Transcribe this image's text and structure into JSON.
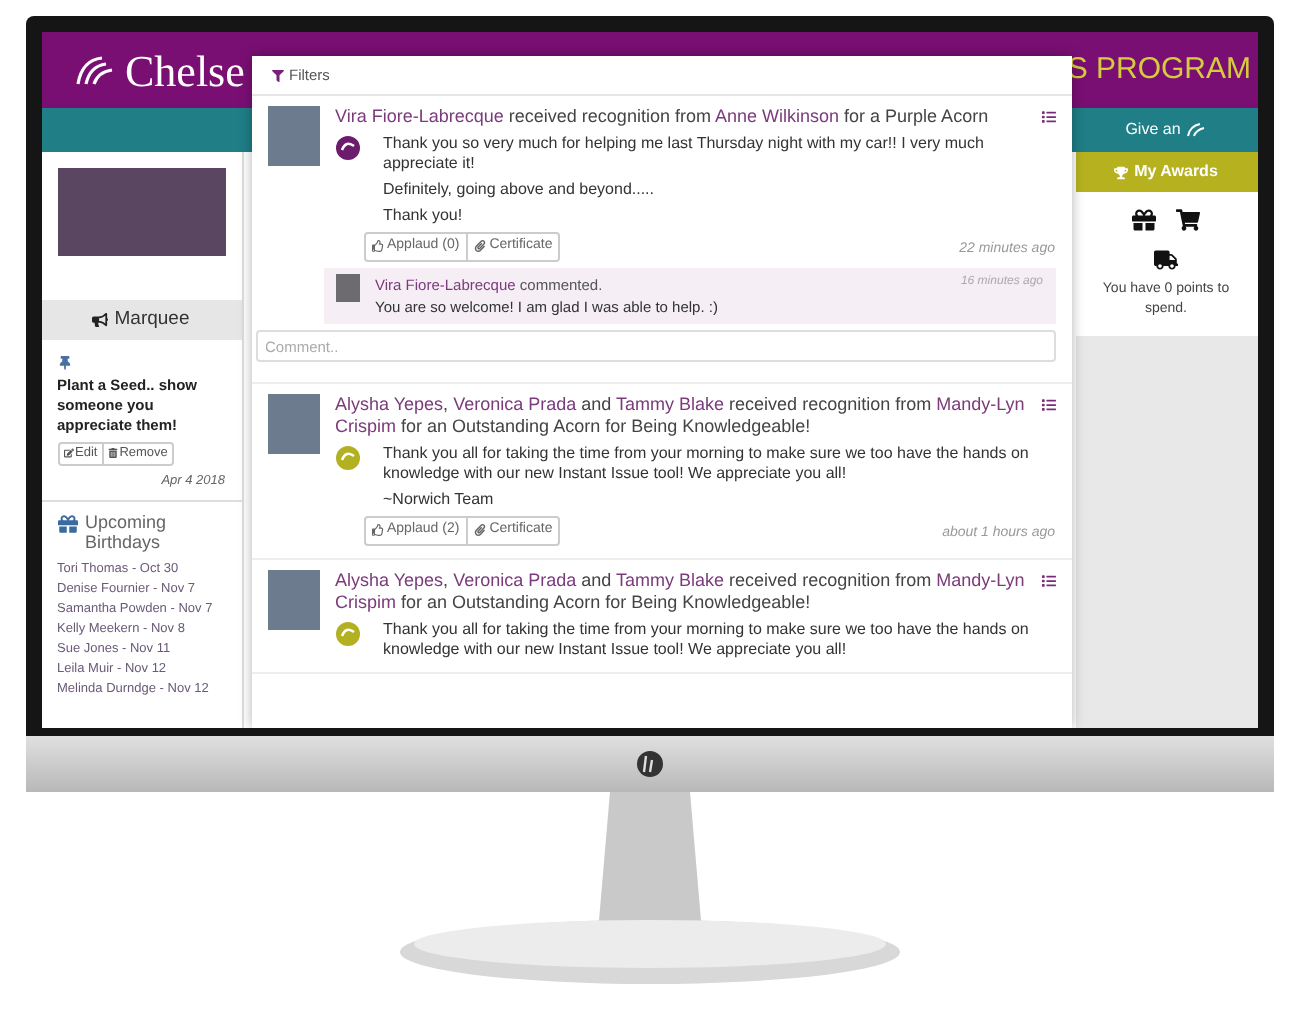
{
  "header": {
    "logo_text": "Chelse",
    "program_text": "S PROGRAM"
  },
  "left_sidebar": {
    "marquee_title": "Marquee",
    "post": {
      "text": "Plant a Seed.. show someone you appreciate them!",
      "buttons": [
        "Edit",
        "Remove"
      ],
      "date": "Apr 4 2018"
    },
    "birthdays": {
      "title": "Upcoming Birthdays",
      "items": [
        "Tori Thomas - Oct 30",
        "Denise Fournier - Nov 7",
        "Samantha Powden - Nov 7",
        "Kelly Meekern - Nov 8",
        "Sue Jones - Nov 11",
        "Leila Muir - Nov 12",
        "Melinda Durndge - Nov 12"
      ]
    }
  },
  "right_sidebar": {
    "give_button": "Give an",
    "awards_button": "My Awards",
    "points_text": "You have 0 points to spend."
  },
  "feed": {
    "filter_label": "Filters",
    "posts": [
      {
        "heading": [
          {
            "text": "Vira Fiore-Labrecque",
            "link": true
          },
          {
            "text": "received recognition from",
            "link": false
          },
          {
            "text": "Anne Wilkinson",
            "link": true
          },
          {
            "text": "for a Purple Acorn",
            "link": false
          }
        ],
        "color": "#6b1d6b",
        "messages": [
          "Thank you so very much for helping me last Thursday night with my car!!  I very much appreciate it!",
          "Definitely, going above and beyond.....",
          "Thank you!"
        ],
        "actions": [
          "Applaud (0)",
          "Certificate"
        ],
        "time": "22 minutes ago",
        "comments": [
          {
            "author": "Vira Fiore-Labrecque",
            "action": "commented.",
            "text": "You are so welcome! I am glad I was able to help. :)",
            "time": "16 minutes ago"
          }
        ],
        "comment_placeholder": "Comment.."
      },
      {
        "heading": [
          {
            "text": "Alysha Yepes",
            "link": true
          },
          {
            "text": ",",
            "link": false
          },
          {
            "text": "Veronica Prada",
            "link": true
          },
          {
            "text": "and",
            "link": false
          },
          {
            "text": "Tammy Blake",
            "link": true
          },
          {
            "text": "received recognition from",
            "link": false
          },
          {
            "text": "Mandy-Lyn Crispim",
            "link": true
          },
          {
            "text": "for an Outstanding Acorn for Being Knowledgeable!",
            "link": false
          }
        ],
        "color": "#b3b022",
        "messages": [
          "Thank you all for taking the time from your morning to make sure we too have the hands on knowledge with our new Instant Issue tool! We appreciate you all!",
          "~Norwich Team"
        ],
        "actions": [
          "Applaud (2)",
          "Certificate"
        ],
        "time": "about 1 hours ago"
      },
      {
        "heading": [
          {
            "text": "Alysha Yepes",
            "link": true
          },
          {
            "text": ",",
            "link": false
          },
          {
            "text": "Veronica Prada",
            "link": true
          },
          {
            "text": "and",
            "link": false
          },
          {
            "text": "Tammy Blake",
            "link": true
          },
          {
            "text": "received recognition from",
            "link": false
          },
          {
            "text": "Mandy-Lyn Crispim",
            "link": true
          },
          {
            "text": "for an Outstanding Acorn for Being Knowledgeable!",
            "link": false
          }
        ],
        "color": "#b3b022",
        "messages": [
          "Thank you all for taking the time from your morning to make sure we too have the hands on knowledge with our new Instant Issue tool! We appreciate you all!"
        ]
      }
    ]
  }
}
